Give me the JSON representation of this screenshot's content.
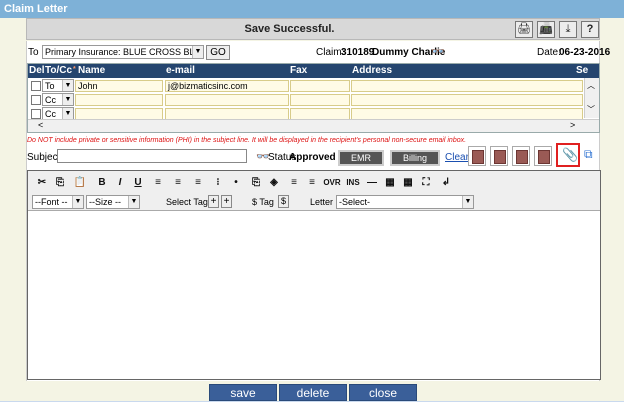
{
  "window": {
    "title": "Claim Letter"
  },
  "status": {
    "message": "Save Successful."
  },
  "toolbar": {
    "print": "🖨",
    "fax": "📠",
    "download": "⤓",
    "help": "?"
  },
  "recipient": {
    "to_label": "To",
    "insurance_value": "Primary Insurance: BLUE CROSS BLUE S",
    "go_label": "GO"
  },
  "claim": {
    "label": "Claim:",
    "number": "310189",
    "patient": "Dummy Charlie"
  },
  "date": {
    "label": "Date:",
    "value": "06-23-2016"
  },
  "grid": {
    "headers": {
      "del": "Del",
      "tocc": "To/Cc",
      "name": "Name",
      "email": "e-mail",
      "fax": "Fax",
      "address": "Address",
      "se": "Se"
    },
    "rows": [
      {
        "tocc": "To",
        "name": "John",
        "email": "j@bizmaticsinc.com",
        "fax": "",
        "address": ""
      },
      {
        "tocc": "Cc",
        "name": "",
        "email": "",
        "fax": "",
        "address": ""
      },
      {
        "tocc": "Cc",
        "name": "",
        "email": "",
        "fax": "",
        "address": ""
      }
    ]
  },
  "phi_warning": "Do NOT include private or sensitive information (PHI) in the subject line. It will be displayed in the recipient's personal non-secure email inbox.",
  "subject": {
    "label": "Subject",
    "value": "",
    "status_label": "Status",
    "status_value": "Approved"
  },
  "docs": {
    "emr": "EMR Docs",
    "billing": "Billing Docs",
    "clear": "Clear"
  },
  "editor": {
    "buttons": [
      "✂",
      "⎘",
      "📋",
      "B",
      "I",
      "U",
      "≡",
      "≡",
      "≡",
      "⁝",
      "•",
      "⎘",
      "◈",
      "≡",
      "≡",
      "OVR",
      "INS",
      "—",
      "▦",
      "▦",
      "⛶",
      "↲"
    ],
    "font": "--Font --",
    "size": "--Size --",
    "select_tag_label": "Select Tag",
    "dollar_tag_label": "$ Tag",
    "letter_label": "Letter",
    "letter_value": "-Select-"
  },
  "actions": {
    "save": "save",
    "delete": "delete",
    "close": "close"
  }
}
